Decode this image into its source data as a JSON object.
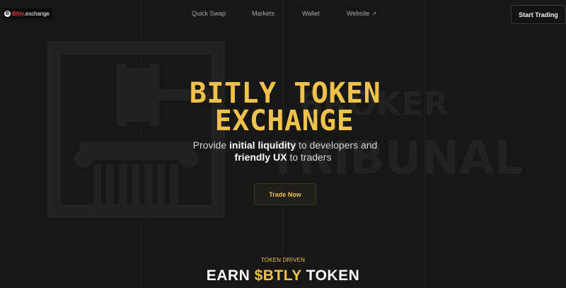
{
  "brand": {
    "mark": "B",
    "name_prefix": "Bitly",
    "name_suffix": ".exchange"
  },
  "nav": {
    "links": [
      "Quick Swap",
      "Markets",
      "Wallet",
      "Website"
    ],
    "external_icon": "arrow-up-right-icon",
    "cta": "Start Trading"
  },
  "watermark": {
    "line1": "BROKER",
    "line2": "TRIBUNAL"
  },
  "hero": {
    "title_line1": "BITLY TOKEN",
    "title_line2": "EXCHANGE",
    "sub1_pre": "Provide ",
    "sub1_bold": "initial liquidity",
    "sub1_post": " to developers and",
    "sub2_bold": "friendly UX",
    "sub2_post": " to traders",
    "cta": "Trade Now"
  },
  "section": {
    "tag": "TOKEN DRIVEN",
    "title_pre": "EARN ",
    "title_highlight": "$BTLY",
    "title_post": " TOKEN"
  },
  "colors": {
    "accent": "#f0c14b",
    "background": "#171716",
    "brand_red": "#e0322d"
  }
}
